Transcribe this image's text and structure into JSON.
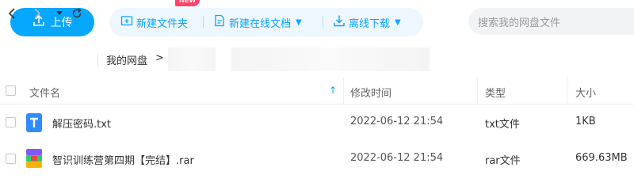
{
  "toolbar": {
    "upload_label": "上传",
    "new_folder_label": "新建文件夹",
    "new_online_doc_label": "新建在线文档",
    "new_badge": "NEW",
    "offline_download_label": "离线下载",
    "search_placeholder": "搜索我的网盘文件",
    "icons": [
      "upload-icon",
      "new-folder-icon",
      "new-doc-icon",
      "download-icon"
    ]
  },
  "nav": {
    "breadcrumb_root": "我的网盘",
    "breadcrumb_sep": ">",
    "icons": [
      "back-icon",
      "forward-icon",
      "dropdown-icon",
      "refresh-icon"
    ]
  },
  "table": {
    "columns": {
      "name": "文件名",
      "modified": "修改时间",
      "type": "类型",
      "size": "大小"
    },
    "sort_indicator": "↑",
    "rows": [
      {
        "name": "解压密码.txt",
        "modified": "2022-06-12 21:54",
        "type": "txt文件",
        "size": "1KB",
        "icon": "txt-file-icon"
      },
      {
        "name": "智识训练营第四期【完结】.rar",
        "modified": "2022-06-12 21:54",
        "type": "rar文件",
        "size": "669.63MB",
        "icon": "rar-file-icon"
      }
    ]
  },
  "colors": {
    "accent": "#06a7ff",
    "badge": "#ff436a",
    "group_bg": "#eef6fe"
  }
}
